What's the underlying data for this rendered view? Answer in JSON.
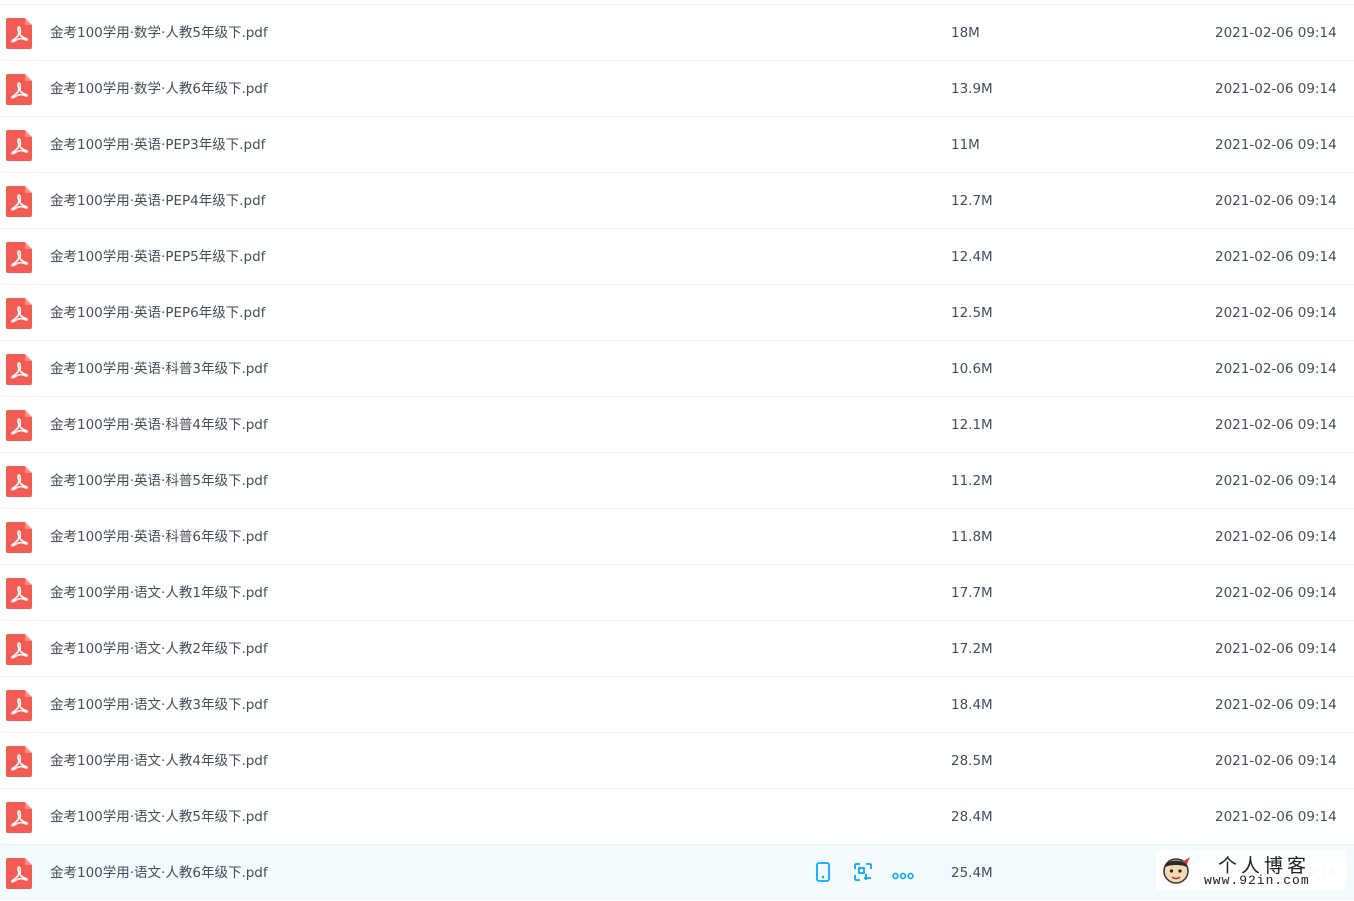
{
  "files": [
    {
      "name": "金考100学用·数学·人教5年级下.pdf",
      "size": "18M",
      "date": "2021-02-06 09:14"
    },
    {
      "name": "金考100学用·数学·人教6年级下.pdf",
      "size": "13.9M",
      "date": "2021-02-06 09:14"
    },
    {
      "name": "金考100学用·英语·PEP3年级下.pdf",
      "size": "11M",
      "date": "2021-02-06 09:14"
    },
    {
      "name": "金考100学用·英语·PEP4年级下.pdf",
      "size": "12.7M",
      "date": "2021-02-06 09:14"
    },
    {
      "name": "金考100学用·英语·PEP5年级下.pdf",
      "size": "12.4M",
      "date": "2021-02-06 09:14"
    },
    {
      "name": "金考100学用·英语·PEP6年级下.pdf",
      "size": "12.5M",
      "date": "2021-02-06 09:14"
    },
    {
      "name": "金考100学用·英语·科普3年级下.pdf",
      "size": "10.6M",
      "date": "2021-02-06 09:14"
    },
    {
      "name": "金考100学用·英语·科普4年级下.pdf",
      "size": "12.1M",
      "date": "2021-02-06 09:14"
    },
    {
      "name": "金考100学用·英语·科普5年级下.pdf",
      "size": "11.2M",
      "date": "2021-02-06 09:14"
    },
    {
      "name": "金考100学用·英语·科普6年级下.pdf",
      "size": "11.8M",
      "date": "2021-02-06 09:14"
    },
    {
      "name": "金考100学用·语文·人教1年级下.pdf",
      "size": "17.7M",
      "date": "2021-02-06 09:14"
    },
    {
      "name": "金考100学用·语文·人教2年级下.pdf",
      "size": "17.2M",
      "date": "2021-02-06 09:14"
    },
    {
      "name": "金考100学用·语文·人教3年级下.pdf",
      "size": "18.4M",
      "date": "2021-02-06 09:14"
    },
    {
      "name": "金考100学用·语文·人教4年级下.pdf",
      "size": "28.5M",
      "date": "2021-02-06 09:14"
    },
    {
      "name": "金考100学用·语文·人教5年级下.pdf",
      "size": "28.4M",
      "date": "2021-02-06 09:14"
    },
    {
      "name": "金考100学用·语文·人教6年级下.pdf",
      "size": "25.4M",
      "date": "2021-02-06 09:14",
      "hovered": true
    }
  ],
  "row_actions": [
    {
      "icon": "phone-icon"
    },
    {
      "icon": "share-icon"
    },
    {
      "icon": "more-icon"
    }
  ],
  "watermark": {
    "title": "个人博客",
    "url": "www.92in.com"
  },
  "colors": {
    "pdf_icon": "#f25c54",
    "action_blue": "#06a7ff",
    "hover_row": "#f4fbff",
    "text": "#454d5a"
  }
}
